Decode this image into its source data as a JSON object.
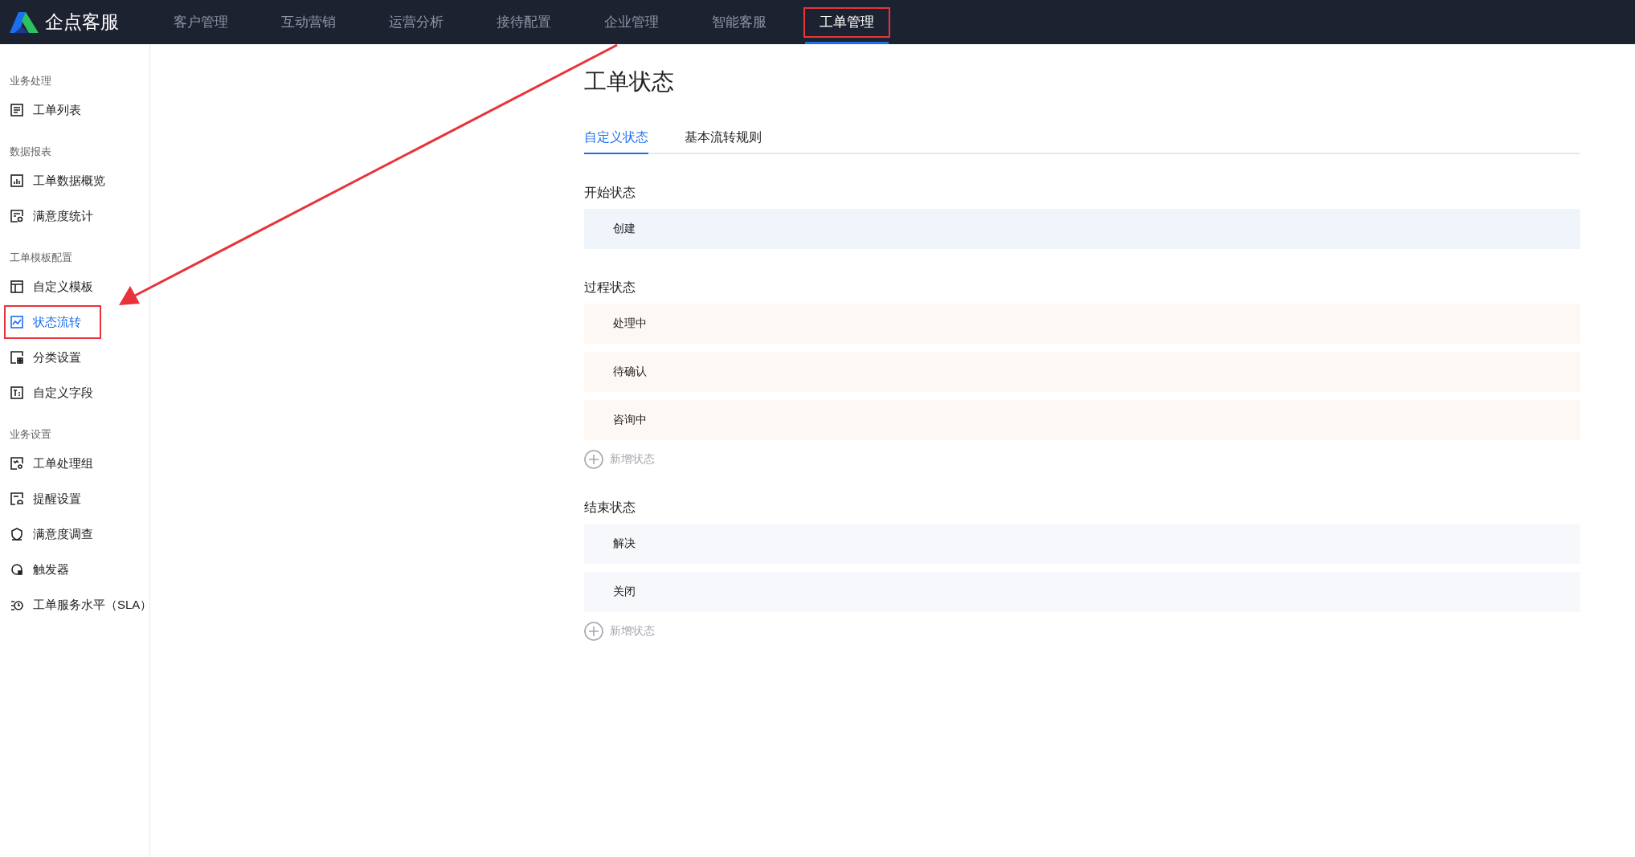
{
  "brand": {
    "name": "企点客服"
  },
  "nav": [
    {
      "label": "客户管理",
      "selected": false,
      "annotated": false
    },
    {
      "label": "互动营销",
      "selected": false,
      "annotated": false
    },
    {
      "label": "运营分析",
      "selected": false,
      "annotated": false
    },
    {
      "label": "接待配置",
      "selected": false,
      "annotated": false
    },
    {
      "label": "企业管理",
      "selected": false,
      "annotated": false
    },
    {
      "label": "智能客服",
      "selected": false,
      "annotated": false
    },
    {
      "label": "工单管理",
      "selected": true,
      "annotated": true
    }
  ],
  "sidebar": {
    "groups": [
      {
        "title": "业务处理",
        "items": [
          {
            "label": "工单列表",
            "selected": false,
            "annotated": false
          }
        ]
      },
      {
        "title": "数据报表",
        "items": [
          {
            "label": "工单数据概览",
            "selected": false,
            "annotated": false
          },
          {
            "label": "满意度统计",
            "selected": false,
            "annotated": false
          }
        ]
      },
      {
        "title": "工单模板配置",
        "items": [
          {
            "label": "自定义模板",
            "selected": false,
            "annotated": false
          },
          {
            "label": "状态流转",
            "selected": true,
            "annotated": true
          },
          {
            "label": "分类设置",
            "selected": false,
            "annotated": false
          },
          {
            "label": "自定义字段",
            "selected": false,
            "annotated": false
          }
        ]
      },
      {
        "title": "业务设置",
        "items": [
          {
            "label": "工单处理组",
            "selected": false,
            "annotated": false
          },
          {
            "label": "提醒设置",
            "selected": false,
            "annotated": false
          },
          {
            "label": "满意度调查",
            "selected": false,
            "annotated": false
          },
          {
            "label": "触发器",
            "selected": false,
            "annotated": false
          },
          {
            "label": "工单服务水平（SLA）",
            "selected": false,
            "annotated": false
          }
        ]
      }
    ]
  },
  "page": {
    "title": "工单状态",
    "tabs": [
      {
        "label": "自定义状态",
        "selected": true
      },
      {
        "label": "基本流转规则",
        "selected": false
      }
    ],
    "sections": [
      {
        "title": "开始状态",
        "color": "#f0f5fc",
        "items": [
          "创建"
        ]
      },
      {
        "title": "过程状态",
        "color": "#fdf8f4",
        "items": [
          "处理中",
          "待确认",
          "咨询中"
        ],
        "add_label": "新增状态"
      },
      {
        "title": "结束状态",
        "color": "#f7f8fb",
        "items": [
          "解决",
          "关闭"
        ],
        "add_label": "新增状态"
      }
    ]
  }
}
